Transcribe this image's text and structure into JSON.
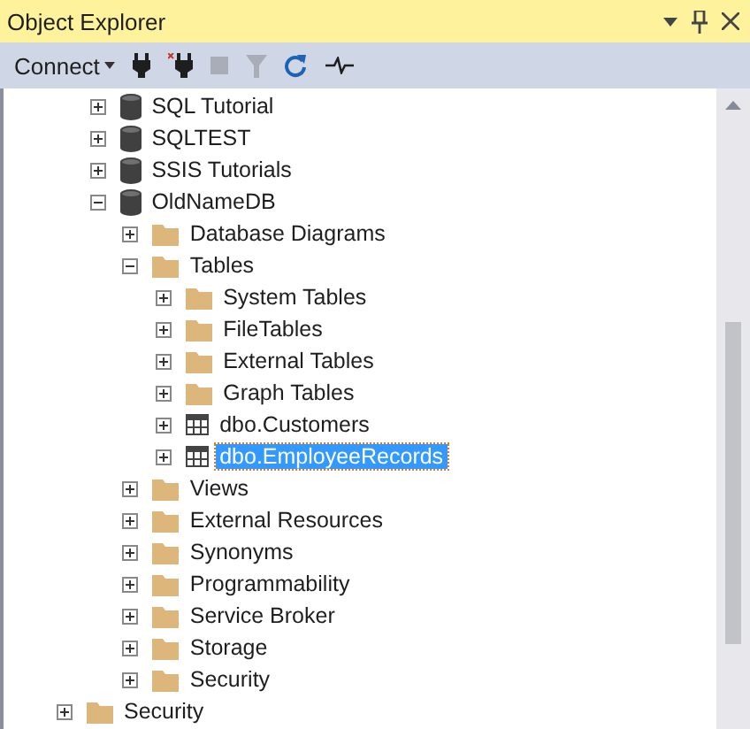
{
  "window": {
    "title": "Object Explorer"
  },
  "toolbar": {
    "connect": {
      "label": "Connect"
    },
    "tools": [
      {
        "kind": "connect",
        "disabled": false
      },
      {
        "kind": "disconnect",
        "disabled": false
      },
      {
        "kind": "stop",
        "disabled": true
      },
      {
        "kind": "filter",
        "disabled": true
      },
      {
        "kind": "refresh",
        "disabled": false
      },
      {
        "kind": "activity",
        "disabled": false
      }
    ]
  },
  "tree": {
    "items": [
      {
        "children": [
          {
            "label": "SQL Tutorial",
            "kind": "database",
            "expanded": false,
            "selected": false
          },
          {
            "label": "SQLTEST",
            "kind": "database",
            "expanded": false,
            "selected": false
          },
          {
            "label": "SSIS Tutorials",
            "kind": "database",
            "expanded": false,
            "selected": false
          },
          {
            "label": "OldNameDB",
            "kind": "database",
            "expanded": true,
            "selected": false,
            "children": [
              {
                "label": "Database Diagrams",
                "kind": "folder",
                "expanded": false,
                "selected": false
              },
              {
                "label": "Tables",
                "kind": "folder",
                "expanded": true,
                "selected": false,
                "children": [
                  {
                    "label": "System Tables",
                    "kind": "folder",
                    "expanded": false,
                    "selected": false
                  },
                  {
                    "label": "FileTables",
                    "kind": "folder",
                    "expanded": false,
                    "selected": false
                  },
                  {
                    "label": "External Tables",
                    "kind": "folder",
                    "expanded": false,
                    "selected": false
                  },
                  {
                    "label": "Graph Tables",
                    "kind": "folder",
                    "expanded": false,
                    "selected": false
                  },
                  {
                    "label": "dbo.Customers",
                    "kind": "table",
                    "expanded": false,
                    "selected": false
                  },
                  {
                    "label": "dbo.EmployeeRecords",
                    "kind": "table",
                    "expanded": false,
                    "selected": true
                  }
                ]
              },
              {
                "label": "Views",
                "kind": "folder",
                "expanded": false,
                "selected": false
              },
              {
                "label": "External Resources",
                "kind": "folder",
                "expanded": false,
                "selected": false
              },
              {
                "label": "Synonyms",
                "kind": "folder",
                "expanded": false,
                "selected": false
              },
              {
                "label": "Programmability",
                "kind": "folder",
                "expanded": false,
                "selected": false
              },
              {
                "label": "Service Broker",
                "kind": "folder",
                "expanded": false,
                "selected": false
              },
              {
                "label": "Storage",
                "kind": "folder",
                "expanded": false,
                "selected": false
              },
              {
                "label": "Security",
                "kind": "folder",
                "expanded": false,
                "selected": false
              }
            ]
          }
        ]
      },
      {
        "label": "Security",
        "kind": "folder",
        "expanded": false,
        "selected": false
      }
    ]
  }
}
